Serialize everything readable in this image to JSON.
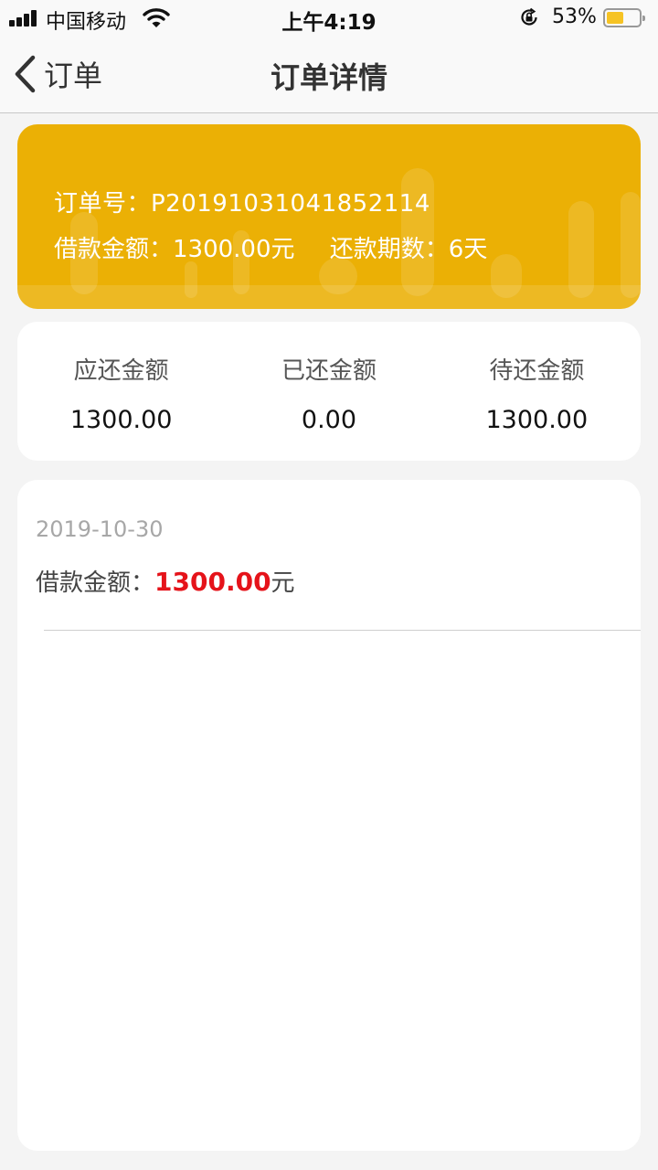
{
  "status_bar": {
    "carrier": "中国移动",
    "time": "上午4:19",
    "battery_percent": "53%",
    "battery_level": 0.53,
    "battery_color": "#f6c324",
    "icons": [
      "signal-icon",
      "wifi-icon",
      "rotation-lock-icon",
      "battery-icon"
    ]
  },
  "nav": {
    "back_label": "订单",
    "title": "订单详情",
    "back_icon": "chevron-left-icon"
  },
  "order": {
    "order_no": "订单号：P20191031041852114",
    "loan_amount": "借款金额：1300.00元",
    "repay_period": "还款期数：6天",
    "banner_color": "#ebb005"
  },
  "summary": [
    {
      "label": "应还金额",
      "value": "1300.00"
    },
    {
      "label": "已还金额",
      "value": "0.00"
    },
    {
      "label": "待还金额",
      "value": "1300.00"
    }
  ],
  "records": [
    {
      "date": "2019-10-30",
      "amount_label": "借款金额：",
      "amount_value": "1300.00",
      "amount_unit": "元",
      "amount_color": "#e5131a"
    }
  ]
}
